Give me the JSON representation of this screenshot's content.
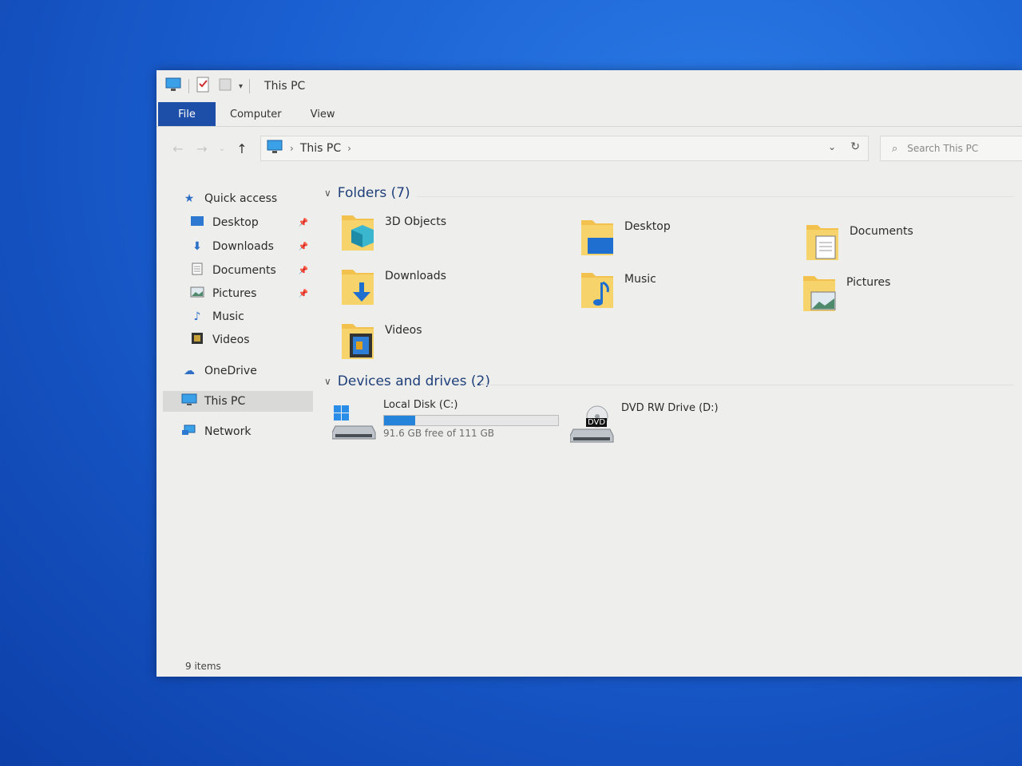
{
  "window": {
    "title": "This PC"
  },
  "ribbon": {
    "tabs": [
      "File",
      "Computer",
      "View"
    ]
  },
  "address": {
    "crumbs": [
      "This PC"
    ]
  },
  "search": {
    "placeholder": "Search This PC"
  },
  "navpane": {
    "items": [
      {
        "label": "Quick access",
        "icon": "star-icon"
      },
      {
        "label": "Desktop",
        "icon": "desktop-icon",
        "pinned": true
      },
      {
        "label": "Downloads",
        "icon": "download-arrow-icon",
        "pinned": true
      },
      {
        "label": "Documents",
        "icon": "document-icon",
        "pinned": true
      },
      {
        "label": "Pictures",
        "icon": "pictures-icon",
        "pinned": true
      },
      {
        "label": "Music",
        "icon": "music-note-icon"
      },
      {
        "label": "Videos",
        "icon": "film-icon"
      },
      {
        "label": "OneDrive",
        "icon": "cloud-icon"
      },
      {
        "label": "This PC",
        "icon": "computer-icon",
        "selected": true
      },
      {
        "label": "Network",
        "icon": "network-icon"
      }
    ]
  },
  "folders": {
    "heading": "Folders (7)",
    "items": [
      {
        "label": "3D Objects",
        "icon": "3d-objects-folder-icon"
      },
      {
        "label": "Desktop",
        "icon": "desktop-folder-icon"
      },
      {
        "label": "Documents",
        "icon": "documents-folder-icon"
      },
      {
        "label": "Downloads",
        "icon": "downloads-folder-icon"
      },
      {
        "label": "Music",
        "icon": "music-folder-icon"
      },
      {
        "label": "Pictures",
        "icon": "pictures-folder-icon"
      },
      {
        "label": "Videos",
        "icon": "videos-folder-icon"
      }
    ]
  },
  "drives": {
    "heading": "Devices and drives (2)",
    "items": [
      {
        "label": "Local Disk (C:)",
        "free_text": "91.6 GB free of 111 GB",
        "used_fraction": 0.18,
        "icon": "windows-drive-icon"
      },
      {
        "label": "DVD RW Drive (D:)",
        "icon": "dvd-drive-icon",
        "badge": "DVD"
      }
    ]
  },
  "status": {
    "items": "9 items"
  },
  "colors": {
    "accent": "#1e4fa8",
    "folder": "#f2c14e",
    "progress": "#2683da",
    "heading": "#1e3f7a"
  }
}
